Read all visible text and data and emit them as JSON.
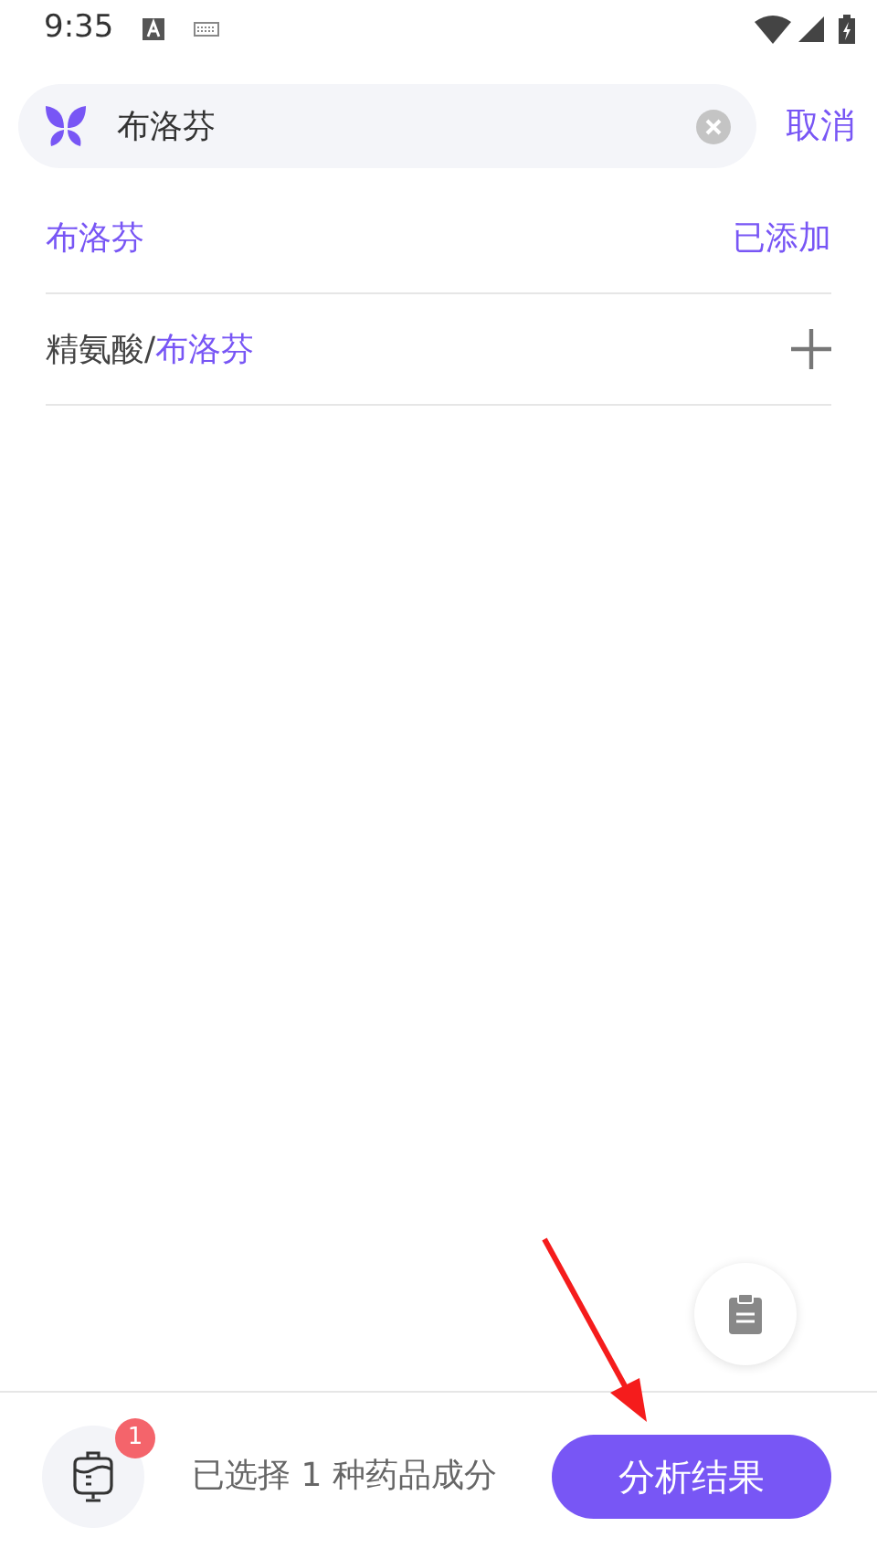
{
  "status_bar": {
    "time": "9:35"
  },
  "search": {
    "value": "布洛芬",
    "cancel": "取消"
  },
  "results": [
    {
      "match": "布洛芬",
      "added": true,
      "status": "已添加"
    },
    {
      "prefix": "精氨酸/",
      "match": "布洛芬",
      "added": false
    }
  ],
  "bottom_bar": {
    "badge": "1",
    "summary": "已选择 1 种药品成分",
    "button": "分析结果"
  }
}
